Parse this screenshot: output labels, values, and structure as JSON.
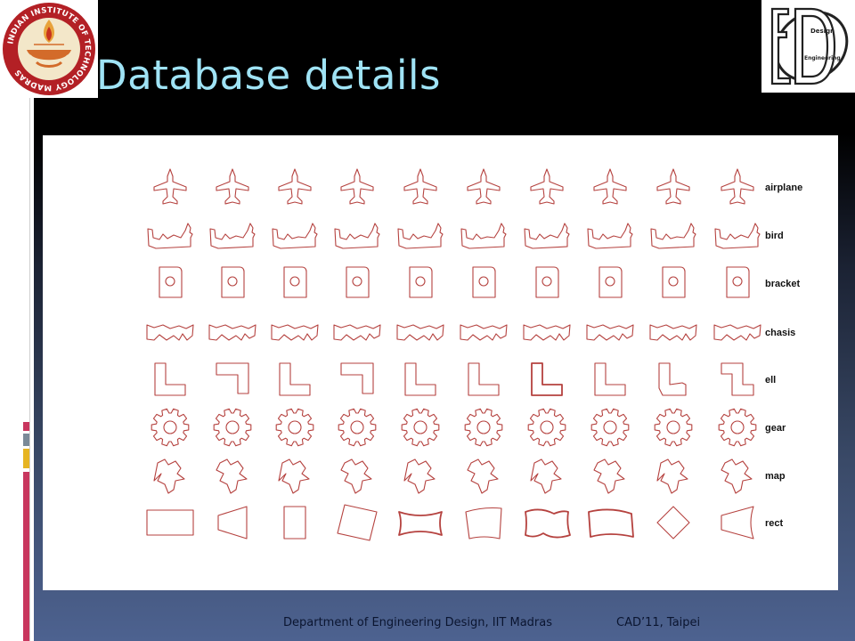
{
  "slide": {
    "title": "Database details",
    "footer_department": "Department of Engineering Design, IIT  Madras",
    "footer_event": "CAD’11, Taipei"
  },
  "logos": {
    "iitm_ring_text": "INDIAN INSTITUTE OF TECHNOLOGY MADRAS",
    "iitm_motto": "सिद्धिर्भवति कर्मजा",
    "ed_word_top": "Design",
    "ed_word_bottom": "Engineering"
  },
  "figure": {
    "shape_color": "#b5423f",
    "categories": [
      {
        "id": "airplane",
        "label": "airplane"
      },
      {
        "id": "bird",
        "label": "bird"
      },
      {
        "id": "bracket",
        "label": "bracket"
      },
      {
        "id": "chasis",
        "label": "chasis"
      },
      {
        "id": "ell",
        "label": "ell"
      },
      {
        "id": "gear",
        "label": "gear"
      },
      {
        "id": "map",
        "label": "map"
      },
      {
        "id": "rect",
        "label": "rect"
      }
    ],
    "samples_per_category": 10
  },
  "colors": {
    "title": "#9fe3f5",
    "accent_pink": "#c8365e",
    "accent_gray": "#7a8a98",
    "accent_gold": "#e6b422"
  }
}
